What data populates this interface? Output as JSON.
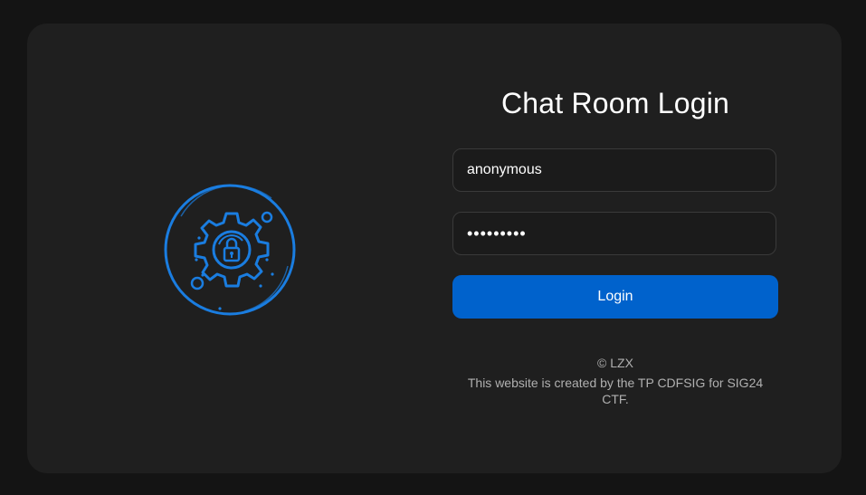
{
  "login": {
    "title": "Chat Room Login",
    "username_value": "anonymous",
    "password_value": "•••••••••",
    "login_label": "Login"
  },
  "footer": {
    "copyright": "© LZX",
    "note": "This website is created by the TP CDFSIG for SIG24 CTF."
  },
  "colors": {
    "accent": "#0062cc",
    "logo": "#1a7de0",
    "card": "#1f1f1f",
    "background": "#141414"
  },
  "icons": {
    "logo": "gear-lock-icon"
  }
}
